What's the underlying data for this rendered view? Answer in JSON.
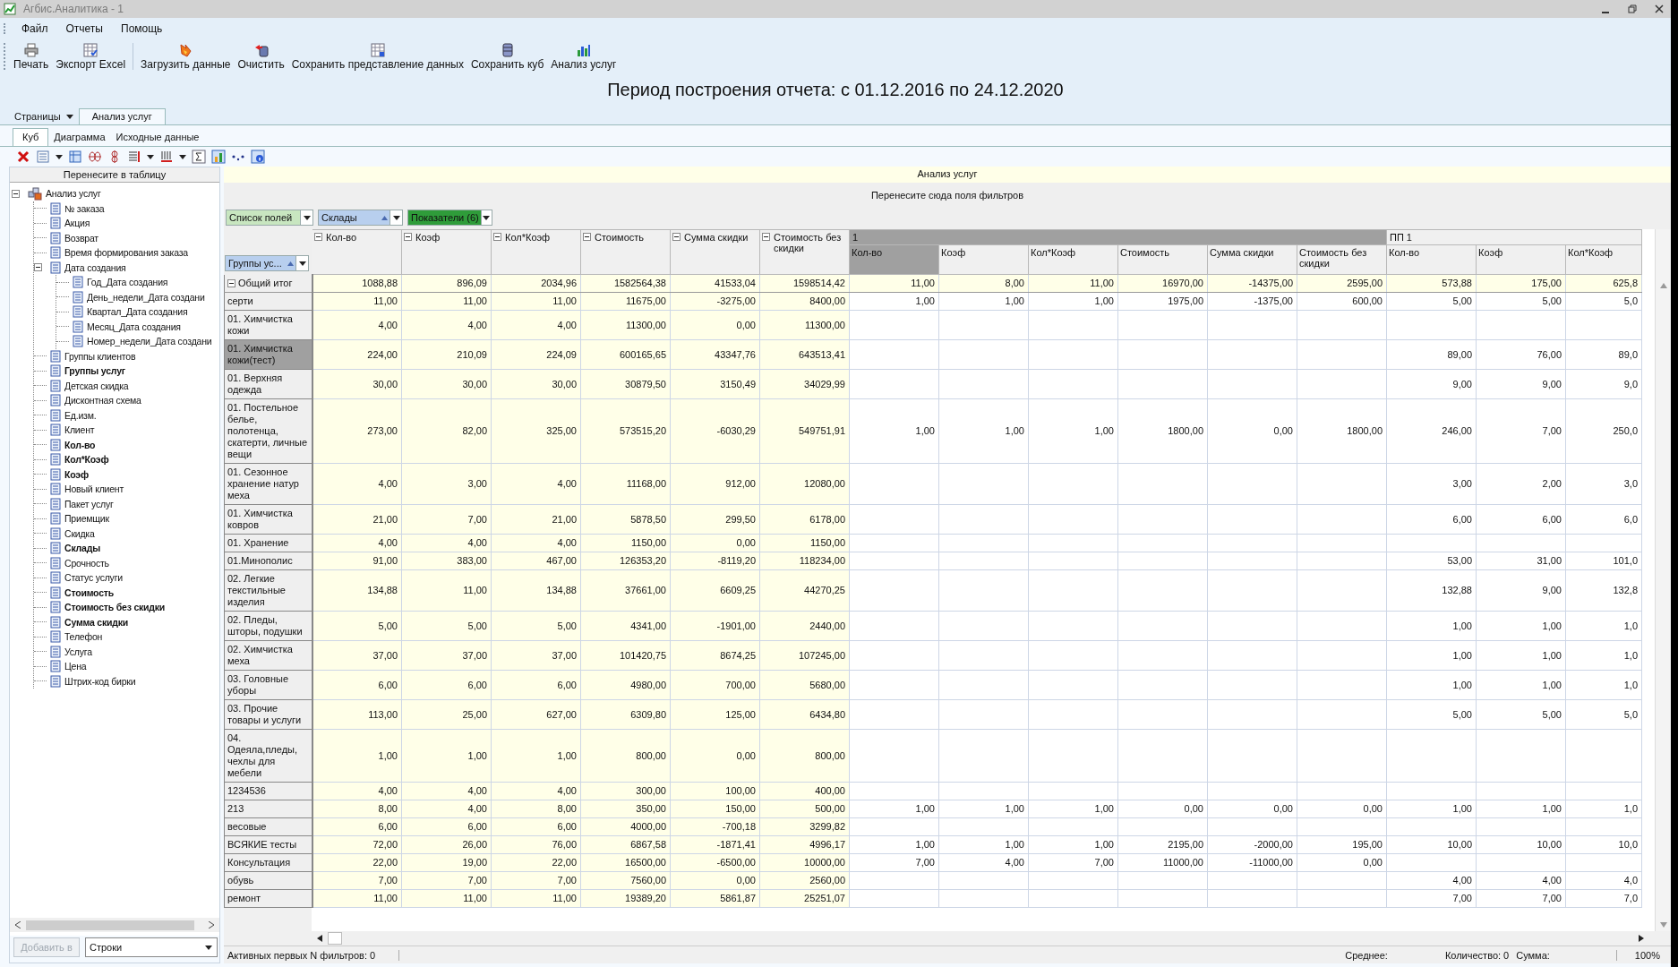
{
  "window": {
    "title": "Агбис.Аналитика - 1"
  },
  "menu": [
    "Файл",
    "Отчеты",
    "Помощь"
  ],
  "toolbar": [
    {
      "label": "Печать",
      "kind": "print"
    },
    {
      "label": "Экспорт Excel",
      "kind": "export"
    },
    {
      "label": "Загрузить данные",
      "kind": "load"
    },
    {
      "label": "Очистить",
      "kind": "clear"
    },
    {
      "label": "Сохранить представление данных",
      "kind": "save_view"
    },
    {
      "label": "Сохранить куб",
      "kind": "save_cube"
    },
    {
      "label": "Анализ услуг",
      "kind": "analysis"
    }
  ],
  "report_period": "Период построения отчета: с 01.12.2016 по 24.12.2020",
  "page_tabs": {
    "menu_label": "Страницы",
    "tabs": [
      {
        "label": "Анализ услуг",
        "selected": true
      }
    ]
  },
  "view_tabs": [
    {
      "label": "Куб",
      "selected": true
    },
    {
      "label": "Диаграмма",
      "selected": false
    },
    {
      "label": "Исходные данные",
      "selected": false
    }
  ],
  "field_panel": {
    "header": "Перенесите в таблицу",
    "tree": [
      {
        "label": "Анализ услуг",
        "expanded": true,
        "in_use": false,
        "children": [
          {
            "label": "№ заказа",
            "in_use": false
          },
          {
            "label": "Акция",
            "in_use": false
          },
          {
            "label": "Возврат",
            "in_use": false
          },
          {
            "label": "Время формирования заказа",
            "in_use": false
          },
          {
            "label": "Дата создания",
            "in_use": false,
            "expanded": true,
            "children": [
              {
                "label": "Год_Дата создания",
                "in_use": false
              },
              {
                "label": "День_недели_Дата создани",
                "in_use": false
              },
              {
                "label": "Квартал_Дата создания",
                "in_use": false
              },
              {
                "label": "Месяц_Дата создания",
                "in_use": false
              },
              {
                "label": "Номер_недели_Дата создани",
                "in_use": false
              }
            ]
          },
          {
            "label": "Группы клиентов",
            "in_use": false
          },
          {
            "label": "Группы услуг",
            "in_use": true
          },
          {
            "label": "Детская скидка",
            "in_use": false
          },
          {
            "label": "Дисконтная схема",
            "in_use": false
          },
          {
            "label": "Ед.изм.",
            "in_use": false
          },
          {
            "label": "Клиент",
            "in_use": false
          },
          {
            "label": "Кол-во",
            "in_use": true
          },
          {
            "label": "Кол*Коэф",
            "in_use": true
          },
          {
            "label": "Коэф",
            "in_use": true
          },
          {
            "label": "Новый клиент",
            "in_use": false
          },
          {
            "label": "Пакет услуг",
            "in_use": false
          },
          {
            "label": "Приемщик",
            "in_use": false
          },
          {
            "label": "Скидка",
            "in_use": false
          },
          {
            "label": "Склады",
            "in_use": true
          },
          {
            "label": "Срочность",
            "in_use": false
          },
          {
            "label": "Статус услуги",
            "in_use": false
          },
          {
            "label": "Стоимость",
            "in_use": true
          },
          {
            "label": "Стоимость без скидки",
            "in_use": true
          },
          {
            "label": "Сумма скидки",
            "in_use": true
          },
          {
            "label": "Телефон",
            "in_use": false
          },
          {
            "label": "Услуга",
            "in_use": false
          },
          {
            "label": "Цена",
            "in_use": false
          },
          {
            "label": "Штрих-код бирки",
            "in_use": false
          }
        ]
      }
    ],
    "add_button": {
      "label": "Добавить в",
      "disabled": true
    },
    "target": "Строки"
  },
  "pivot": {
    "caption": "Анализ услуг",
    "filter_hint": "Перенесите сюда поля фильтров",
    "field_buttons": [
      {
        "label": "Список полей",
        "kind": "list"
      },
      {
        "label": "Склады",
        "kind": "column"
      },
      {
        "label": "Показатели (6)",
        "kind": "data"
      }
    ],
    "row_field": "Группы ус...",
    "column_groups": [
      {
        "kind": "total",
        "measures": [
          {
            "label": "Кол-во",
            "selected": false
          },
          {
            "label": "Коэф",
            "selected": false
          },
          {
            "label": "Кол*Коэф",
            "selected": false
          },
          {
            "label": "Стоимость",
            "selected": false
          },
          {
            "label": "Сумма скидки",
            "selected": false
          },
          {
            "label": "Стоимость без скидки",
            "selected": false
          }
        ]
      },
      {
        "kind": "group",
        "label": "1",
        "selected": true,
        "measures": [
          {
            "label": "Кол-во",
            "selected": true
          },
          {
            "label": "Коэф",
            "selected": false
          },
          {
            "label": "Кол*Коэф",
            "selected": false
          },
          {
            "label": "Стоимость",
            "selected": false
          },
          {
            "label": "Сумма скидки",
            "selected": false
          },
          {
            "label": "Стоимость без скидки",
            "selected": false
          }
        ]
      },
      {
        "kind": "group",
        "label": "ПП 1",
        "selected": false,
        "measures": [
          {
            "label": "Кол-во",
            "selected": false
          },
          {
            "label": "Коэф",
            "selected": false
          },
          {
            "label": "Кол*Коэф",
            "selected": false
          }
        ]
      }
    ],
    "rows": [
      {
        "label": "Общий итог",
        "kind": "total",
        "selected": false,
        "cells": [
          "1088,88",
          "896,09",
          "2034,96",
          "1582564,38",
          "41533,04",
          "1598514,42",
          "11,00",
          "8,00",
          "11,00",
          "16970,00",
          "-14375,00",
          "2595,00",
          "573,88",
          "175,00",
          "625,8"
        ]
      },
      {
        "label": "серти",
        "kind": "item",
        "selected": false,
        "cells": [
          "11,00",
          "11,00",
          "11,00",
          "11675,00",
          "-3275,00",
          "8400,00",
          "1,00",
          "1,00",
          "1,00",
          "1975,00",
          "-1375,00",
          "600,00",
          "5,00",
          "5,00",
          "5,0"
        ]
      },
      {
        "label": "01.  Химчистка кожи",
        "kind": "item",
        "selected": false,
        "cells": [
          "4,00",
          "4,00",
          "4,00",
          "11300,00",
          "0,00",
          "11300,00",
          null,
          null,
          null,
          null,
          null,
          null,
          null,
          null,
          null
        ]
      },
      {
        "label": "01.  Химчистка кожи(тест)",
        "kind": "item",
        "selected": true,
        "cells": [
          "224,00",
          "210,09",
          "224,09",
          "600165,65",
          "43347,76",
          "643513,41",
          null,
          null,
          null,
          null,
          null,
          null,
          "89,00",
          "76,00",
          "89,0"
        ]
      },
      {
        "label": "01. Верхняя одежда",
        "kind": "item",
        "selected": false,
        "cells": [
          "30,00",
          "30,00",
          "30,00",
          "30879,50",
          "3150,49",
          "34029,99",
          null,
          null,
          null,
          null,
          null,
          null,
          "9,00",
          "9,00",
          "9,0"
        ]
      },
      {
        "label": "01. Постельное белье, полотенца, скатерти, личные вещи",
        "kind": "item",
        "selected": false,
        "cells": [
          "273,00",
          "82,00",
          "325,00",
          "573515,20",
          "-6030,29",
          "549751,91",
          "1,00",
          "1,00",
          "1,00",
          "1800,00",
          "0,00",
          "1800,00",
          "246,00",
          "7,00",
          "250,0"
        ]
      },
      {
        "label": "01. Сезонное хранение натур меха",
        "kind": "item",
        "selected": false,
        "cells": [
          "4,00",
          "3,00",
          "4,00",
          "11168,00",
          "912,00",
          "12080,00",
          null,
          null,
          null,
          null,
          null,
          null,
          "3,00",
          "2,00",
          "3,0"
        ]
      },
      {
        "label": "01. Химчистка ковров",
        "kind": "item",
        "selected": false,
        "cells": [
          "21,00",
          "7,00",
          "21,00",
          "5878,50",
          "299,50",
          "6178,00",
          null,
          null,
          null,
          null,
          null,
          null,
          "6,00",
          "6,00",
          "6,0"
        ]
      },
      {
        "label": "01. Хранение",
        "kind": "item",
        "selected": false,
        "cells": [
          "4,00",
          "4,00",
          "4,00",
          "1150,00",
          "0,00",
          "1150,00",
          null,
          null,
          null,
          null,
          null,
          null,
          null,
          null,
          null
        ]
      },
      {
        "label": "01.Минополис",
        "kind": "item",
        "selected": false,
        "cells": [
          "91,00",
          "383,00",
          "467,00",
          "126353,20",
          "-8119,20",
          "118234,00",
          null,
          null,
          null,
          null,
          null,
          null,
          "53,00",
          "31,00",
          "101,0"
        ]
      },
      {
        "label": "02. Легкие текстильные изделия",
        "kind": "item",
        "selected": false,
        "cells": [
          "134,88",
          "11,00",
          "134,88",
          "37661,00",
          "6609,25",
          "44270,25",
          null,
          null,
          null,
          null,
          null,
          null,
          "132,88",
          "9,00",
          "132,8"
        ]
      },
      {
        "label": "02. Пледы, шторы, подушки",
        "kind": "item",
        "selected": false,
        "cells": [
          "5,00",
          "5,00",
          "5,00",
          "4341,00",
          "-1901,00",
          "2440,00",
          null,
          null,
          null,
          null,
          null,
          null,
          "1,00",
          "1,00",
          "1,0"
        ]
      },
      {
        "label": "02. Химчистка меха",
        "kind": "item",
        "selected": false,
        "cells": [
          "37,00",
          "37,00",
          "37,00",
          "101420,75",
          "8674,25",
          "107245,00",
          null,
          null,
          null,
          null,
          null,
          null,
          "1,00",
          "1,00",
          "1,0"
        ]
      },
      {
        "label": "03. Головные уборы",
        "kind": "item",
        "selected": false,
        "cells": [
          "6,00",
          "6,00",
          "6,00",
          "4980,00",
          "700,00",
          "5680,00",
          null,
          null,
          null,
          null,
          null,
          null,
          "1,00",
          "1,00",
          "1,0"
        ]
      },
      {
        "label": "03. Прочие товары и услуги",
        "kind": "item",
        "selected": false,
        "cells": [
          "113,00",
          "25,00",
          "627,00",
          "6309,80",
          "125,00",
          "6434,80",
          null,
          null,
          null,
          null,
          null,
          null,
          "5,00",
          "5,00",
          "5,0"
        ]
      },
      {
        "label": "04. Одеяла,пледы, чехлы для мебели",
        "kind": "item",
        "selected": false,
        "cells": [
          "1,00",
          "1,00",
          "1,00",
          "800,00",
          "0,00",
          "800,00",
          null,
          null,
          null,
          null,
          null,
          null,
          null,
          null,
          null
        ]
      },
      {
        "label": "1234536",
        "kind": "item",
        "selected": false,
        "cells": [
          "4,00",
          "4,00",
          "4,00",
          "300,00",
          "100,00",
          "400,00",
          null,
          null,
          null,
          null,
          null,
          null,
          null,
          null,
          null
        ]
      },
      {
        "label": "213",
        "kind": "item",
        "selected": false,
        "cells": [
          "8,00",
          "4,00",
          "8,00",
          "350,00",
          "150,00",
          "500,00",
          "1,00",
          "1,00",
          "1,00",
          "0,00",
          "0,00",
          "0,00",
          "1,00",
          "1,00",
          "1,0"
        ]
      },
      {
        "label": "весовые",
        "kind": "item",
        "selected": false,
        "cells": [
          "6,00",
          "6,00",
          "6,00",
          "4000,00",
          "-700,18",
          "3299,82",
          null,
          null,
          null,
          null,
          null,
          null,
          null,
          null,
          null
        ]
      },
      {
        "label": "ВСЯКИЕ тесты",
        "kind": "item",
        "selected": false,
        "cells": [
          "72,00",
          "26,00",
          "76,00",
          "6867,58",
          "-1871,41",
          "4996,17",
          "1,00",
          "1,00",
          "1,00",
          "2195,00",
          "-2000,00",
          "195,00",
          "10,00",
          "10,00",
          "10,0"
        ]
      },
      {
        "label": "Консультация",
        "kind": "item",
        "selected": false,
        "cells": [
          "22,00",
          "19,00",
          "22,00",
          "16500,00",
          "-6500,00",
          "10000,00",
          "7,00",
          "4,00",
          "7,00",
          "11000,00",
          "-11000,00",
          "0,00",
          null,
          null,
          null
        ]
      },
      {
        "label": "обувь",
        "kind": "item",
        "selected": false,
        "cells": [
          "7,00",
          "7,00",
          "7,00",
          "7560,00",
          "0,00",
          "2560,00",
          null,
          null,
          null,
          null,
          null,
          null,
          "4,00",
          "4,00",
          "4,0"
        ]
      },
      {
        "label": "ремонт",
        "kind": "item",
        "selected": false,
        "cells": [
          "11,00",
          "11,00",
          "11,00",
          "19389,20",
          "5861,87",
          "25251,07",
          null,
          null,
          null,
          null,
          null,
          null,
          "7,00",
          "7,00",
          "7,0"
        ]
      }
    ]
  },
  "status_bar": {
    "filters": "Активных первых N фильтров: 0",
    "average": "Среднее:",
    "count": "Количество: 0",
    "sum": "Сумма:",
    "zoom": "100%"
  }
}
